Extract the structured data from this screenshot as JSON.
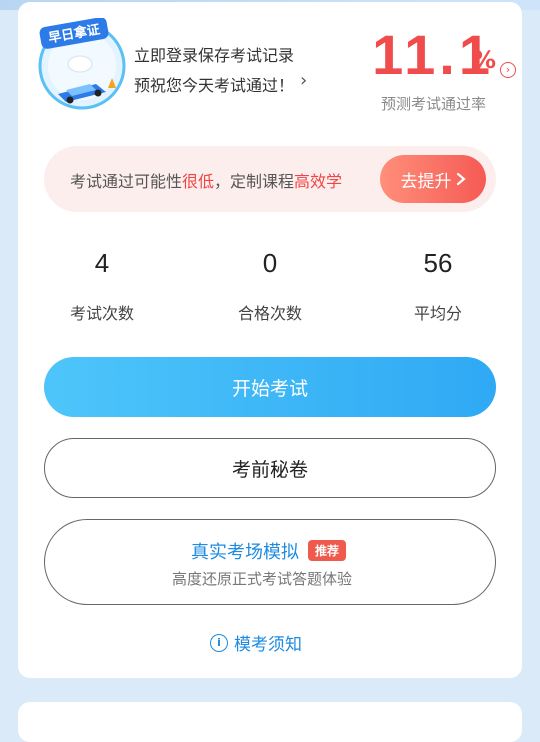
{
  "badge": {
    "title": "早日拿证"
  },
  "promo": {
    "line1": "立即登录保存考试记录",
    "line2": "预祝您今天考试通过！",
    "arrow": "›"
  },
  "prediction": {
    "rate": "11.1",
    "unit": "%",
    "label": "预测考试通过率",
    "info_icon": "chevron-right-icon"
  },
  "hint": {
    "prefix": "考试通过可能性",
    "low": "很低",
    "middle": "，定制课程",
    "high": "高效学",
    "button_label": "去提升",
    "button_icon": "chevron-right-icon"
  },
  "stats": [
    {
      "value": "4",
      "label": "考试次数"
    },
    {
      "value": "0",
      "label": "合格次数"
    },
    {
      "value": "56",
      "label": "平均分"
    }
  ],
  "actions": {
    "start": "开始考试",
    "secret": "考前秘卷",
    "mock_title": "真实考场模拟",
    "mock_tag": "推荐",
    "mock_sub": "高度还原正式考试答题体验"
  },
  "notice": {
    "label": "模考须知",
    "icon": "info-icon"
  },
  "colors": {
    "accent_red": "#f04c4c",
    "accent_blue": "#2fa9f4",
    "link_blue": "#1e8be0"
  }
}
